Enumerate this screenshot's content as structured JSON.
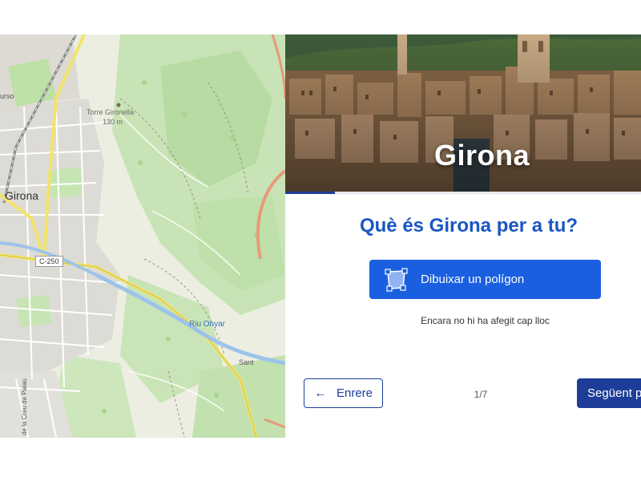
{
  "map": {
    "labels": {
      "city": "Girona",
      "peak_name": "Torre Gironella",
      "peak_elevation": "130 m",
      "river": "Riu Onyar",
      "road": "C-250",
      "small_top": "urso",
      "street_vertical": "de la Creu de Palau",
      "small_right": "Sant"
    }
  },
  "hero": {
    "title": "Girona",
    "progress_fraction": 0.14
  },
  "panel": {
    "question": "Què és Girona per a tu?",
    "draw_button_label": "Dibuixar un polígon",
    "draw_icon": "polygon-draw-icon",
    "empty_text": "Encara no hi ha afegit cap lloc"
  },
  "nav": {
    "back_label": "Enrere",
    "back_icon": "arrow-left-icon",
    "page_indicator": "1/7",
    "next_label": "Següent p"
  },
  "colors": {
    "accent": "#1a5fe0",
    "heading": "#1a56c4",
    "nav_dark": "#1d3d98"
  }
}
